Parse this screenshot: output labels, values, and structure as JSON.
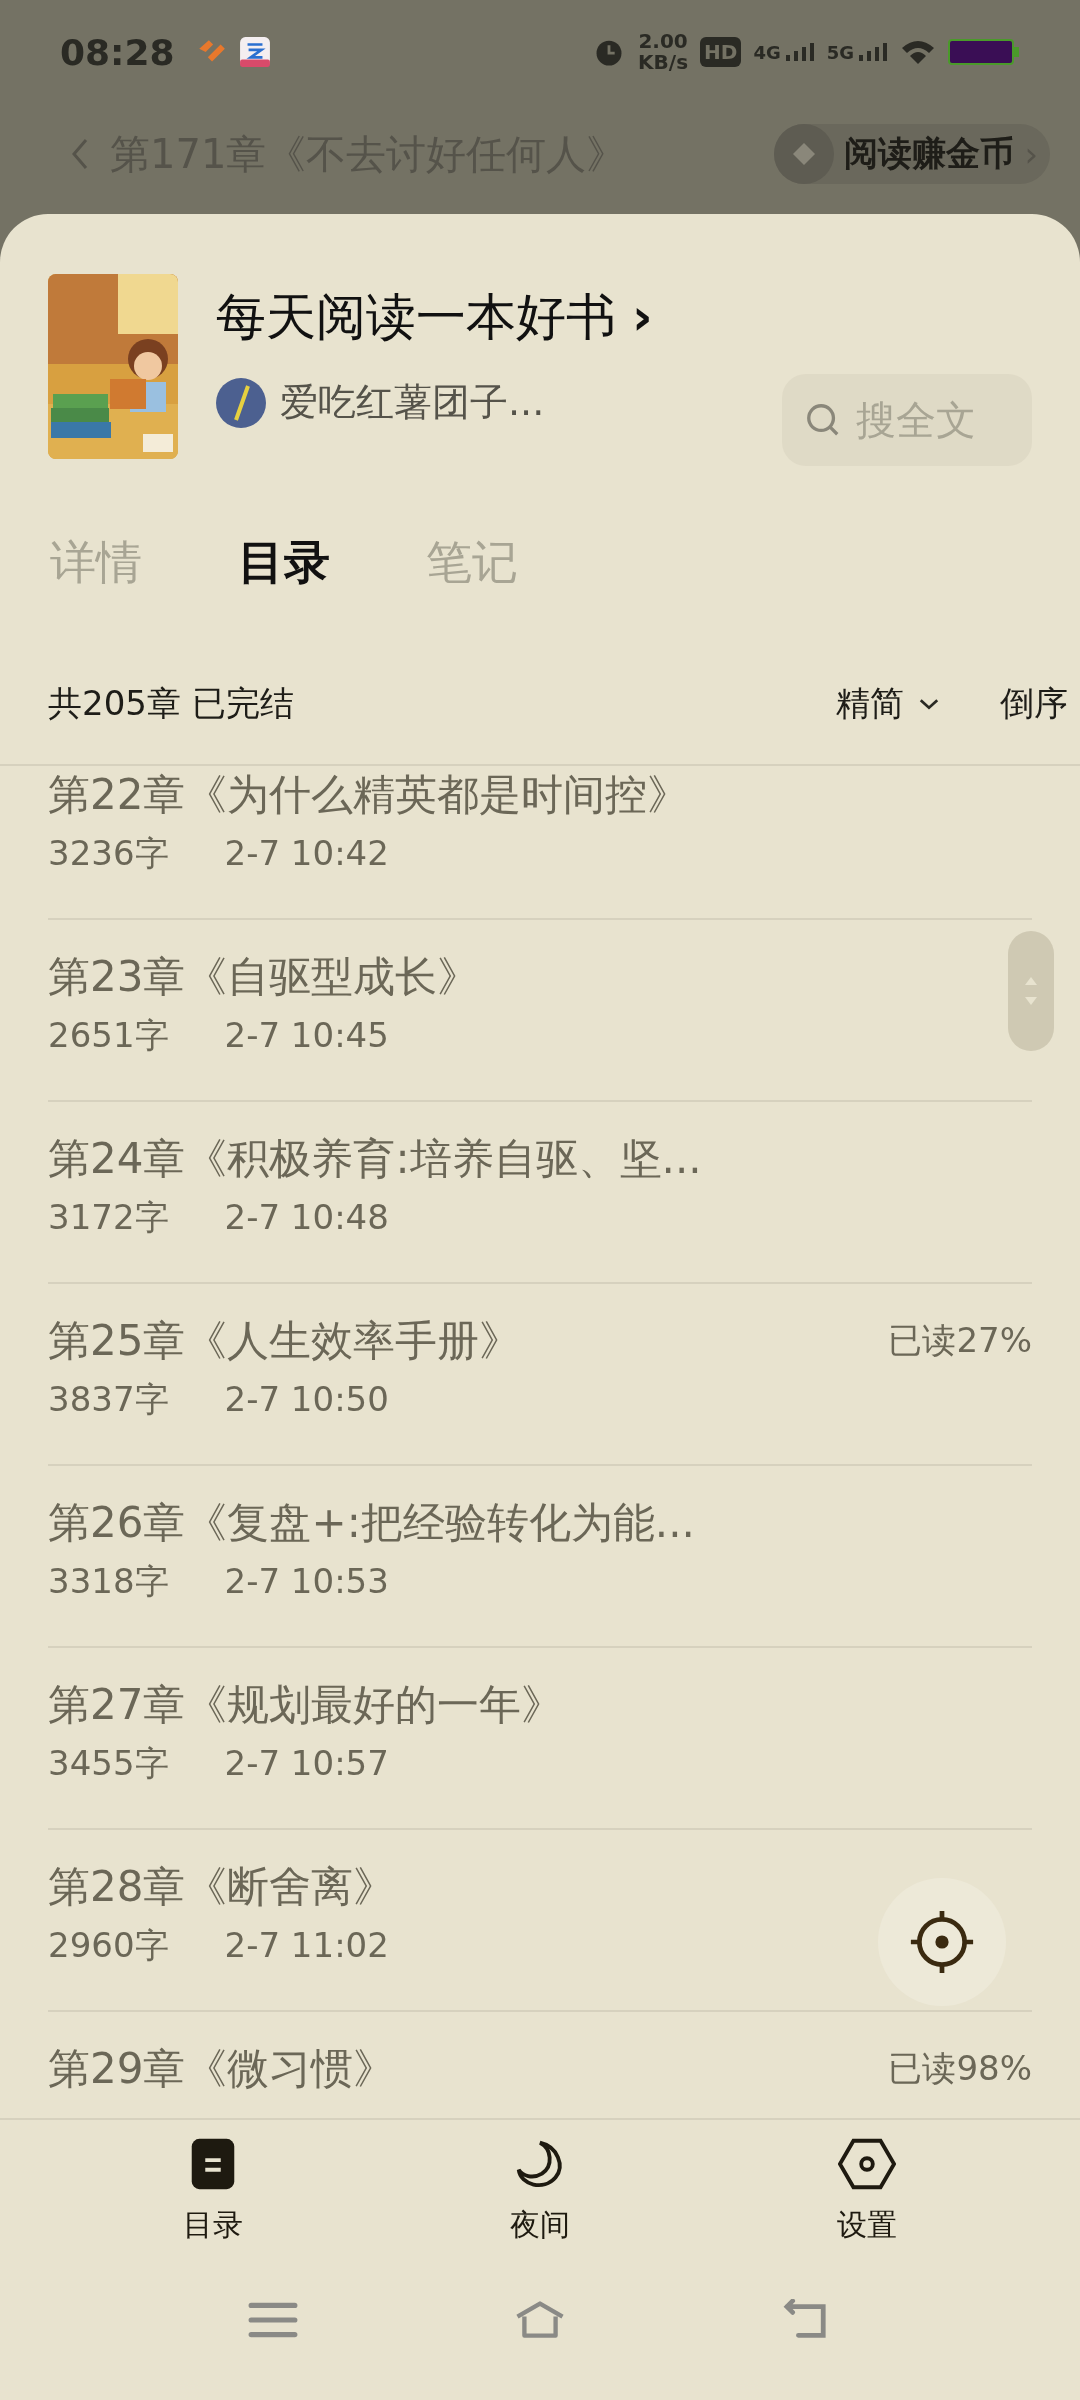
{
  "status_bar": {
    "time": "08:28",
    "net_speed": "2.00",
    "net_unit": "KB/s",
    "hd": "HD",
    "sim1": "4G",
    "sim2": "5G"
  },
  "reader_bar": {
    "chapter": "第171章《不去讨好任何人》",
    "coin_button": "阅读赚金币",
    "coin_chevron": "›"
  },
  "book": {
    "title": "每天阅读一本好书",
    "title_chevron": "›",
    "author": "爱吃红薯团子...",
    "search": {
      "placeholder": "搜全文"
    }
  },
  "tabs": [
    {
      "label": "详情",
      "selected": false
    },
    {
      "label": "目录",
      "selected": true
    },
    {
      "label": "笔记",
      "selected": false
    }
  ],
  "summary": {
    "count": "共205章 已完结",
    "filter": "精简",
    "order": "倒序"
  },
  "chapters": [
    {
      "title": "第22章《为什么精英都是时间控》",
      "words": "3236字",
      "date": "2-7 10:42"
    },
    {
      "title": "第23章《自驱型成长》",
      "words": "2651字",
      "date": "2-7 10:45"
    },
    {
      "title": "第24章《积极养育:培养自驱、坚...",
      "words": "3172字",
      "date": "2-7 10:48"
    },
    {
      "title": "第25章《人生效率手册》",
      "words": "3837字",
      "date": "2-7 10:50",
      "progress": "已读27%"
    },
    {
      "title": "第26章《复盘+:把经验转化为能...",
      "words": "3318字",
      "date": "2-7 10:53"
    },
    {
      "title": "第27章《规划最好的一年》",
      "words": "3455字",
      "date": "2-7 10:57"
    },
    {
      "title": "第28章《断舍离》",
      "words": "2960字",
      "date": "2-7 11:02"
    },
    {
      "title": "第29章《微习惯》",
      "progress": "已读98%"
    }
  ],
  "bottom_tabs": [
    {
      "label": "目录",
      "kind": "toc"
    },
    {
      "label": "夜间",
      "kind": "night"
    },
    {
      "label": "设置",
      "kind": "settings"
    }
  ]
}
